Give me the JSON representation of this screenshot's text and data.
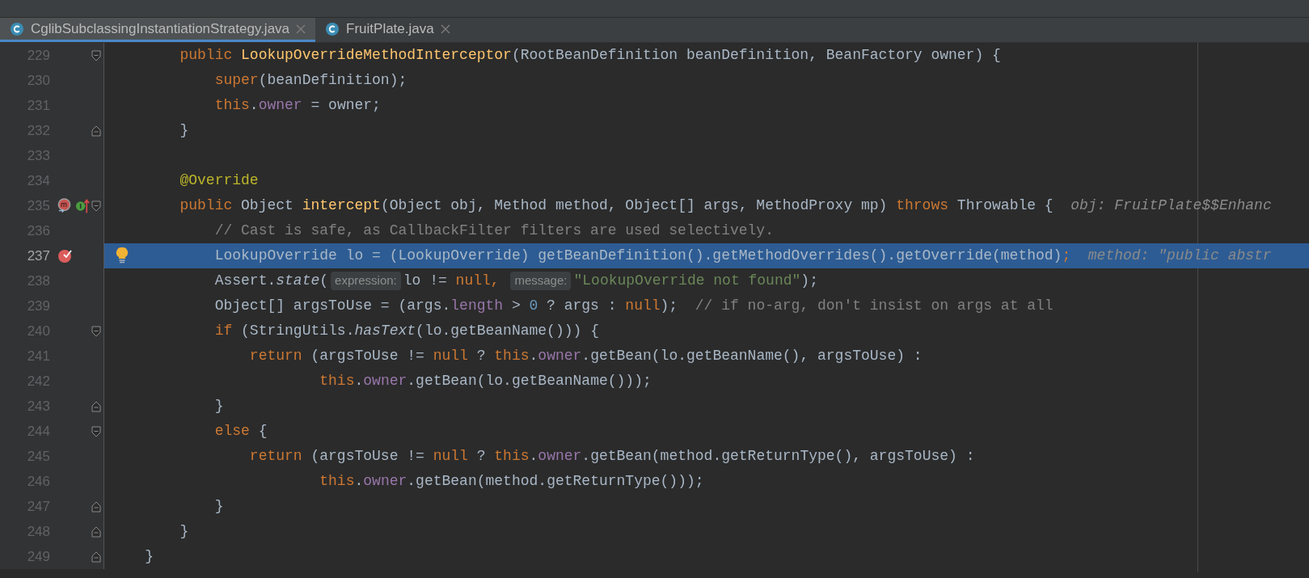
{
  "tabs": [
    {
      "label": "CglibSubclassingInstantiationStrategy.java",
      "selected": true
    },
    {
      "label": "FruitPlate.java",
      "selected": false
    }
  ],
  "lines": [
    {
      "number": "229",
      "selected": false,
      "markers": [
        {
          "kind": "fold_start"
        }
      ],
      "tokens": [
        {
          "kind": "keyword",
          "text": "        public "
        },
        {
          "kind": "method",
          "text": "LookupOverrideMethodInterceptor"
        },
        {
          "kind": "plain",
          "text": "(RootBeanDefinition beanDefinition, BeanFactory owner) {"
        }
      ]
    },
    {
      "number": "230",
      "selected": false,
      "tokens": [
        {
          "kind": "keyword",
          "text": "            super"
        },
        {
          "kind": "plain",
          "text": "(beanDefinition);"
        }
      ]
    },
    {
      "number": "231",
      "selected": false,
      "tokens": [
        {
          "kind": "keyword",
          "text": "            this"
        },
        {
          "kind": "plain",
          "text": "."
        },
        {
          "kind": "field",
          "text": "owner"
        },
        {
          "kind": "plain",
          "text": " = owner;"
        }
      ]
    },
    {
      "number": "232",
      "selected": false,
      "markers": [
        {
          "kind": "fold_end"
        }
      ],
      "tokens": [
        {
          "kind": "plain",
          "text": "        }"
        }
      ]
    },
    {
      "number": "233",
      "selected": false
    },
    {
      "number": "234",
      "selected": false,
      "tokens": [
        {
          "kind": "annotation",
          "text": "        @Override"
        }
      ]
    },
    {
      "number": "235",
      "selected": false,
      "markers": [
        {
          "kind": "override"
        },
        {
          "kind": "implements"
        },
        {
          "kind": "fold_start"
        }
      ],
      "tokens": [
        {
          "kind": "keyword",
          "text": "        public "
        },
        {
          "kind": "plain",
          "text": "Object "
        },
        {
          "kind": "method",
          "text": "intercept"
        },
        {
          "kind": "plain",
          "text": "(Object obj, Method method, Object[] args, MethodProxy mp) "
        },
        {
          "kind": "keyword",
          "text": "throws "
        },
        {
          "kind": "plain",
          "text": "Throwable {  "
        },
        {
          "kind": "debug",
          "text": "obj: FruitPlate$$Enhanc"
        }
      ]
    },
    {
      "number": "236",
      "selected": false,
      "tokens": [
        {
          "kind": "comment",
          "text": "            // Cast is safe, as CallbackFilter filters are used selectively."
        }
      ]
    },
    {
      "number": "237",
      "selected": true,
      "markers": [
        {
          "kind": "breakpoint"
        },
        {
          "kind": "bulb"
        }
      ],
      "tokens": [
        {
          "kind": "plain",
          "text": "            LookupOverride lo = (LookupOverride) getBeanDefinition().getMethodOverrides().getOverride(method)"
        },
        {
          "kind": "keyword",
          "text": ";  "
        },
        {
          "kind": "debug",
          "text": "method: \"public abstr"
        }
      ]
    },
    {
      "number": "238",
      "selected": false,
      "tokens": [
        {
          "kind": "plain",
          "text": "            Assert."
        },
        {
          "kind": "static",
          "text": "state"
        },
        {
          "kind": "plain",
          "text": "("
        },
        {
          "kind": "hint",
          "text": "expression:"
        },
        {
          "kind": "plain",
          "text": "lo != "
        },
        {
          "kind": "keyword",
          "text": "null"
        },
        {
          "kind": "keyword",
          "text": ", "
        },
        {
          "kind": "hint",
          "text": "message:"
        },
        {
          "kind": "string",
          "text": "\"LookupOverride not found\""
        },
        {
          "kind": "plain",
          "text": ");"
        }
      ]
    },
    {
      "number": "239",
      "selected": false,
      "tokens": [
        {
          "kind": "plain",
          "text": "            Object[] argsToUse = (args."
        },
        {
          "kind": "field",
          "text": "length"
        },
        {
          "kind": "plain",
          "text": " > "
        },
        {
          "kind": "number",
          "text": "0"
        },
        {
          "kind": "plain",
          "text": " ? args : "
        },
        {
          "kind": "keyword",
          "text": "null"
        },
        {
          "kind": "plain",
          "text": ");  "
        },
        {
          "kind": "comment",
          "text": "// if no-arg, don't insist on args at all"
        }
      ]
    },
    {
      "number": "240",
      "selected": false,
      "markers": [
        {
          "kind": "fold_start"
        }
      ],
      "tokens": [
        {
          "kind": "keyword",
          "text": "            if "
        },
        {
          "kind": "plain",
          "text": "(StringUtils."
        },
        {
          "kind": "static",
          "text": "hasText"
        },
        {
          "kind": "plain",
          "text": "(lo.getBeanName())) {"
        }
      ]
    },
    {
      "number": "241",
      "selected": false,
      "tokens": [
        {
          "kind": "keyword",
          "text": "                return "
        },
        {
          "kind": "plain",
          "text": "(argsToUse != "
        },
        {
          "kind": "keyword",
          "text": "null"
        },
        {
          "kind": "plain",
          "text": " ? "
        },
        {
          "kind": "keyword",
          "text": "this"
        },
        {
          "kind": "plain",
          "text": "."
        },
        {
          "kind": "field",
          "text": "owner"
        },
        {
          "kind": "plain",
          "text": ".getBean(lo.getBeanName(), argsToUse) :"
        }
      ]
    },
    {
      "number": "242",
      "selected": false,
      "tokens": [
        {
          "kind": "keyword",
          "text": "                        this"
        },
        {
          "kind": "plain",
          "text": "."
        },
        {
          "kind": "field",
          "text": "owner"
        },
        {
          "kind": "plain",
          "text": ".getBean(lo.getBeanName()));"
        }
      ]
    },
    {
      "number": "243",
      "selected": false,
      "markers": [
        {
          "kind": "fold_end"
        }
      ],
      "tokens": [
        {
          "kind": "plain",
          "text": "            }"
        }
      ]
    },
    {
      "number": "244",
      "selected": false,
      "markers": [
        {
          "kind": "fold_start"
        }
      ],
      "tokens": [
        {
          "kind": "keyword",
          "text": "            else "
        },
        {
          "kind": "plain",
          "text": "{"
        }
      ]
    },
    {
      "number": "245",
      "selected": false,
      "tokens": [
        {
          "kind": "keyword",
          "text": "                return "
        },
        {
          "kind": "plain",
          "text": "(argsToUse != "
        },
        {
          "kind": "keyword",
          "text": "null"
        },
        {
          "kind": "plain",
          "text": " ? "
        },
        {
          "kind": "keyword",
          "text": "this"
        },
        {
          "kind": "plain",
          "text": "."
        },
        {
          "kind": "field",
          "text": "owner"
        },
        {
          "kind": "plain",
          "text": ".getBean(method.getReturnType(), argsToUse) :"
        }
      ]
    },
    {
      "number": "246",
      "selected": false,
      "tokens": [
        {
          "kind": "keyword",
          "text": "                        this"
        },
        {
          "kind": "plain",
          "text": "."
        },
        {
          "kind": "field",
          "text": "owner"
        },
        {
          "kind": "plain",
          "text": ".getBean(method.getReturnType()));"
        }
      ]
    },
    {
      "number": "247",
      "selected": false,
      "markers": [
        {
          "kind": "fold_end"
        }
      ],
      "tokens": [
        {
          "kind": "plain",
          "text": "            }"
        }
      ]
    },
    {
      "number": "248",
      "selected": false,
      "markers": [
        {
          "kind": "fold_end"
        }
      ],
      "tokens": [
        {
          "kind": "plain",
          "text": "        }"
        }
      ]
    },
    {
      "number": "249",
      "selected": false,
      "markers": [
        {
          "kind": "fold_end"
        }
      ],
      "tokens": [
        {
          "kind": "plain",
          "text": "    }"
        }
      ]
    }
  ]
}
